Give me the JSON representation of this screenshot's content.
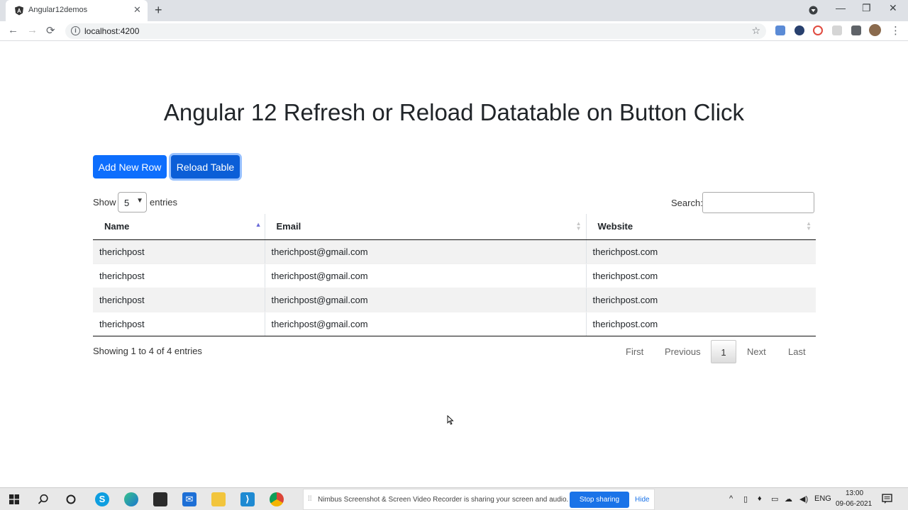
{
  "browser": {
    "tab_title": "Angular12demos",
    "url": "localhost:4200",
    "new_tab": "+",
    "tab_close": "✕"
  },
  "page": {
    "title": "Angular 12 Refresh or Reload Datatable on Button Click",
    "add_button": "Add New Row",
    "reload_button": "Reload Table",
    "length": {
      "prefix": "Show",
      "value": "5",
      "suffix": "entries"
    },
    "search_label": "Search:",
    "columns": [
      "Name",
      "Email",
      "Website"
    ],
    "rows": [
      [
        "therichpost",
        "therichpost@gmail.com",
        "therichpost.com"
      ],
      [
        "therichpost",
        "therichpost@gmail.com",
        "therichpost.com"
      ],
      [
        "therichpost",
        "therichpost@gmail.com",
        "therichpost.com"
      ],
      [
        "therichpost",
        "therichpost@gmail.com",
        "therichpost.com"
      ]
    ],
    "info": "Showing 1 to 4 of 4 entries",
    "pagination": {
      "first": "First",
      "previous": "Previous",
      "current": "1",
      "next": "Next",
      "last": "Last"
    }
  },
  "taskbar": {
    "share_text": "Nimbus Screenshot & Screen Video Recorder is sharing your screen and audio.",
    "stop_sharing": "Stop sharing",
    "hide": "Hide",
    "language": "ENG",
    "time": "13:00",
    "date": "09-06-2021"
  },
  "colors": {
    "primary": "#0d6efd",
    "primary_active": "#0b5ed7",
    "stop_sharing": "#1a73e8"
  }
}
